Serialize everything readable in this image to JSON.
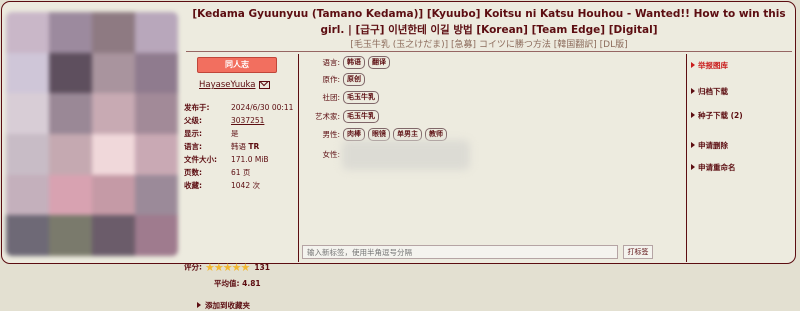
{
  "title_main": "[Kedama Gyuunyuu (Tamano Kedama)] [Kyuubo] Koitsu ni Katsu Houhou - Wanted!! How to win this girl. | [급구] 이년한테 이길 방법 [Korean] [Team Edge] [Digital]",
  "title_jp": "[毛玉牛乳 (玉之けだま)] [急募] コイツに勝つ方法 [韓国翻訳] [DL版]",
  "category": "同人志",
  "uploader": "HayaseYuuka",
  "info": [
    {
      "key": "发布于:",
      "value": "2024/6/30 00:11"
    },
    {
      "key": "父级:",
      "value": "3037251"
    },
    {
      "key": "显示:",
      "value": "是"
    },
    {
      "key": "语言:",
      "value": "韩语",
      "extra": "TR"
    },
    {
      "key": "文件大小:",
      "value": "171.0 MiB"
    },
    {
      "key": "页数:",
      "value": "61 页"
    },
    {
      "key": "收藏:",
      "value": "1042 次"
    }
  ],
  "rating": {
    "label": "评分:",
    "stars": "★★★★★",
    "count": "131",
    "average_label": "平均值:",
    "average": "4.81"
  },
  "favorite_link": "添加到收藏夹",
  "tag_groups": [
    {
      "ns": "语言:",
      "tags": [
        "韩语",
        "翻译"
      ]
    },
    {
      "ns": "原作:",
      "tags": [
        "原创"
      ]
    },
    {
      "ns": "社团:",
      "tags": [
        "毛玉牛乳"
      ]
    },
    {
      "ns": "艺术家:",
      "tags": [
        "毛玉牛乳"
      ]
    },
    {
      "ns": "男性:",
      "tags": [
        "肉棒",
        "眼镜",
        "单男主",
        "教师"
      ]
    },
    {
      "ns": "女性:",
      "tags": []
    }
  ],
  "new_tag_placeholder": "输入新标签，使用半角逗号分隔",
  "tag_button": "打标签",
  "actions": [
    {
      "label": "举报图库",
      "red": true
    },
    {
      "label": "归档下载",
      "red": false
    },
    {
      "label": "种子下载 (2)",
      "red": false
    },
    {
      "label": "申请删除",
      "red": false
    },
    {
      "label": "申请重命名",
      "red": false
    }
  ],
  "colors": {
    "background": "#e3e0d1",
    "panel": "#edebdf",
    "text": "#5c0d11",
    "category": "#f26f5f",
    "stars": "#f2b832",
    "report": "#c91c1c"
  }
}
